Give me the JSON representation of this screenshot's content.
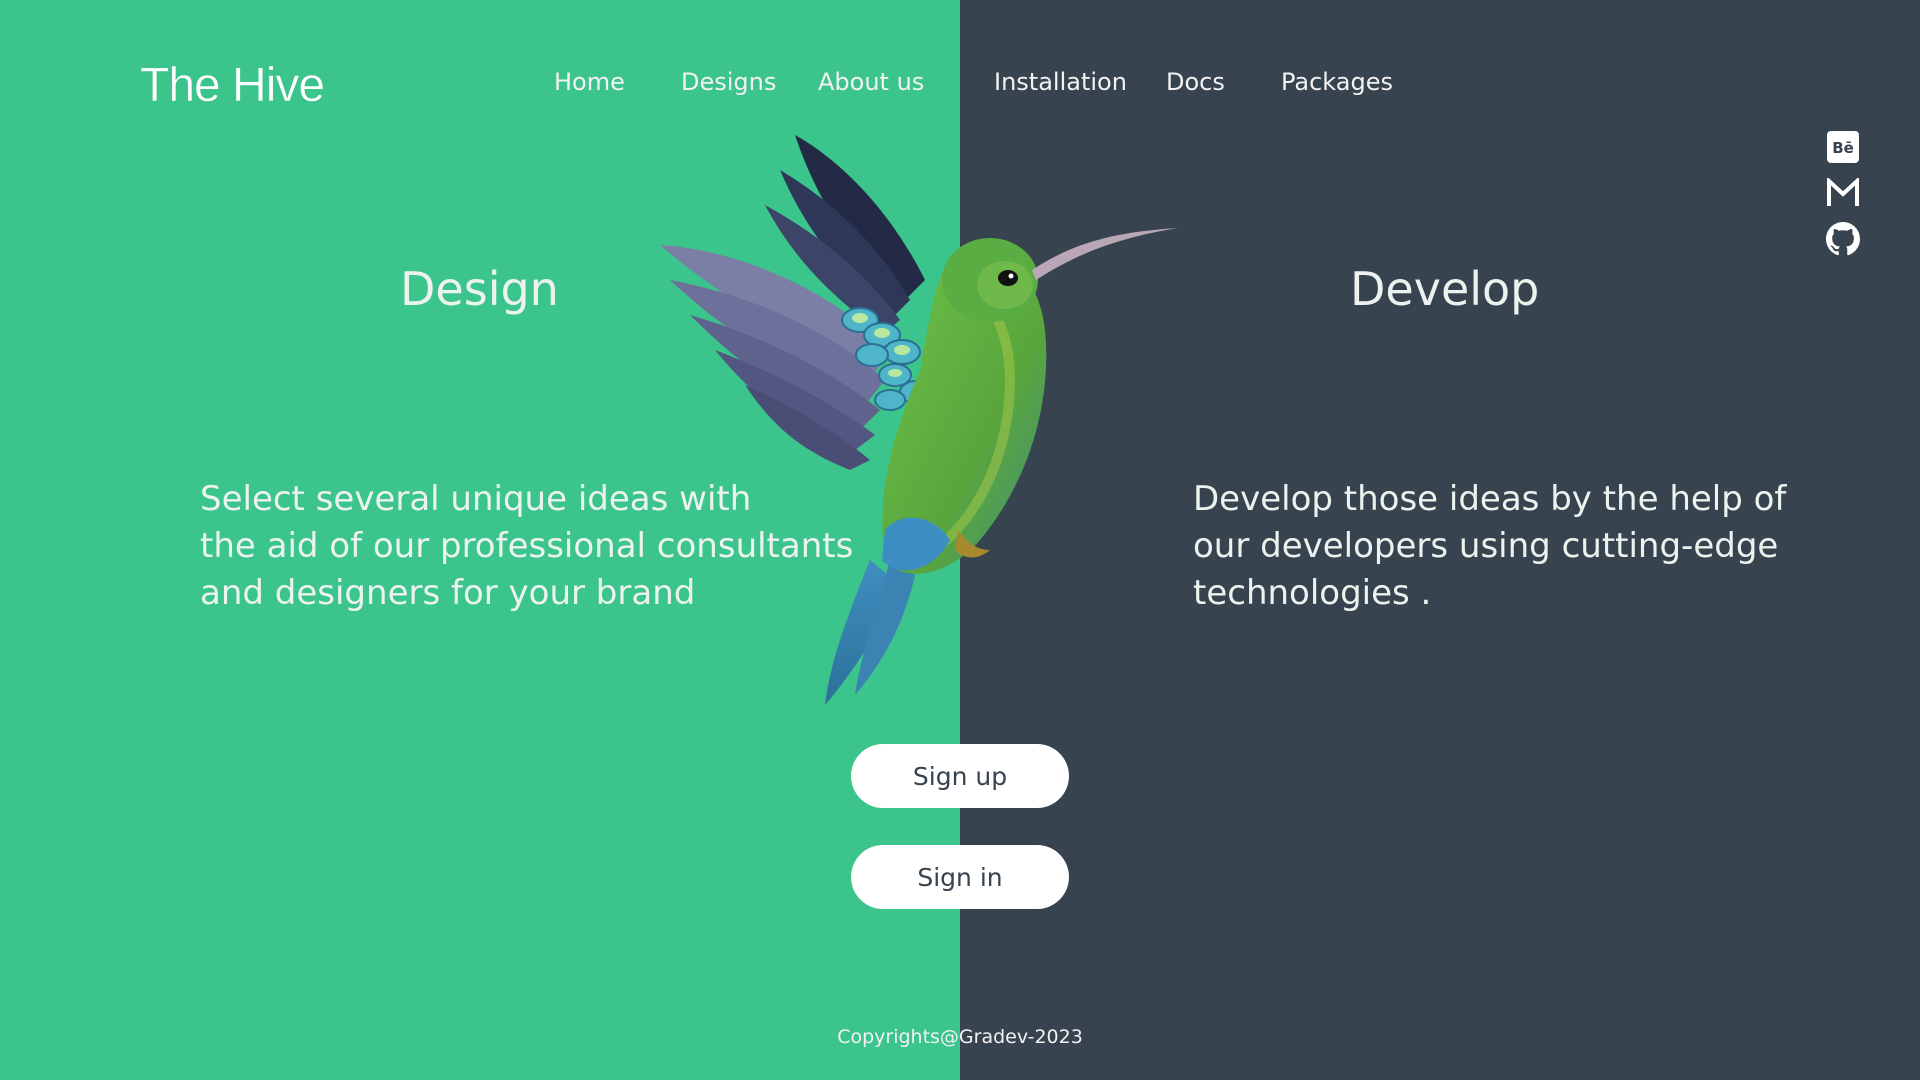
{
  "brand": {
    "logo": "The Hive"
  },
  "nav": {
    "left": [
      "Home",
      "Designs",
      "About us"
    ],
    "right": [
      "Installation",
      "Docs",
      "Packages"
    ]
  },
  "social": {
    "behance_text": "Bē",
    "icons": [
      "behance-icon",
      "gmail-icon",
      "github-icon"
    ]
  },
  "design": {
    "title": "Design",
    "lines": [
      "Select several unique ideas with",
      "the aid of our professional consultants",
      "and designers for your brand"
    ]
  },
  "develop": {
    "title": "Develop",
    "lines": [
      "Develop those ideas by the help of",
      "our developers using cutting-edge",
      "technologies ."
    ]
  },
  "buttons": {
    "signup": "Sign up",
    "signin": "Sign in"
  },
  "footer": {
    "copyright": "Copyrights@Gradev-2023"
  },
  "colors": {
    "green": "#3bc48c",
    "slate": "#37434f",
    "white": "#ffffff"
  }
}
